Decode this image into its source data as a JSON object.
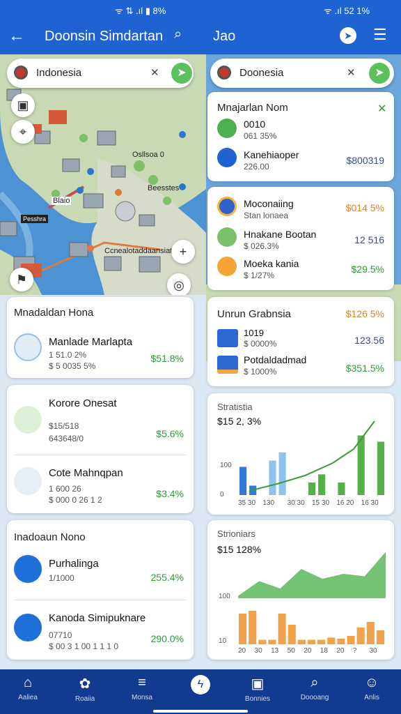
{
  "status": {
    "left": "ᯤ ⇅ .ıl ▮ 8%",
    "right": "ᯤ .ıl 52 1%"
  },
  "appbar": {
    "title": "Doonsin Simdartan",
    "title2": "Jao"
  },
  "map_left": {
    "search_text": "Indonesia",
    "labels": [
      "Osllsoa 0",
      "Beesstes",
      "Blaio",
      "Pesshra",
      "Ccnealotaddaansiate"
    ]
  },
  "map_right": {
    "search_text": "Doonesia"
  },
  "popup1": {
    "title": "Mnajarlan Nom",
    "items": [
      {
        "name": "0010",
        "sub": "061 35%",
        "value": ""
      },
      {
        "name": "Kanehiaoper",
        "sub": "226.00",
        "value": "$800319"
      }
    ]
  },
  "popup2": {
    "items": [
      {
        "name": "Moconaiing",
        "sub": "Stan lonaea",
        "value": "$014 5%"
      },
      {
        "name": "Hnakane Bootan",
        "sub": "$ 026.3%",
        "value": "12 516"
      },
      {
        "name": "Moeka kania",
        "sub": "$ 1/27%",
        "value": "$29.5%"
      }
    ]
  },
  "card_a": {
    "title": "Mnadaldan Hona",
    "items": [
      {
        "name": "Manlade Marlapta",
        "sub1": "1 51.0 2%",
        "sub2": "$ 5 0035 5%",
        "value": "$51.8%"
      }
    ]
  },
  "card_b": {
    "items": [
      {
        "name": "Korore Onesat",
        "sub1": "$15/518",
        "sub2": "643648/0",
        "value": "$5.6%"
      },
      {
        "name": "Cote Mahnqpan",
        "sub1": "1 600 26",
        "sub2": "$ 000 0 26 1 2",
        "value": "$3.4%"
      }
    ]
  },
  "card_c": {
    "title": "Inadoaun Nono",
    "items": [
      {
        "name": "Purhalinga",
        "sub1": "1/1000",
        "value": "255.4%"
      },
      {
        "name": "Kanoda Simipuknare",
        "sub1": "07710",
        "sub2": "$ 00 3 1 00 1 1 1 0",
        "value": "290.0%"
      }
    ]
  },
  "card_d": {
    "title": "Unrun Grabnsia",
    "items": [
      {
        "name": "1019",
        "sub": "$ 0000%",
        "value": "123.56"
      },
      {
        "name": "Potdaldadmad",
        "sub": "$ 1000%",
        "value": "$351.5%"
      }
    ],
    "top_value": "$126 5%"
  },
  "chart1": {
    "title": "Stratistia",
    "big": "$15 2, 3%",
    "ytick": [
      "100",
      "0"
    ],
    "xticks": [
      "35 30",
      "130",
      "30 30",
      "15 30",
      "16 20",
      "16 30"
    ],
    "chart_data": {
      "type": "bar",
      "series": [
        {
          "values": [
            45,
            15,
            0,
            0,
            0,
            0,
            0,
            0,
            0,
            0,
            0,
            0,
            0,
            0,
            0
          ]
        },
        {
          "values": [
            0,
            0,
            0,
            55,
            68,
            0,
            0,
            0,
            0,
            0,
            0,
            0,
            0,
            0,
            0
          ]
        },
        {
          "values": [
            0,
            0,
            0,
            0,
            0,
            0,
            0,
            20,
            33,
            0,
            20,
            0,
            95,
            0,
            85
          ]
        }
      ]
    }
  },
  "chart2": {
    "title": "Strioniars",
    "big": "$15 128%",
    "ytick": [
      "100",
      "10"
    ],
    "xticks": [
      "20",
      "30",
      "13",
      "50",
      "20",
      "18",
      "20",
      "?",
      "30"
    ],
    "chart_data": {
      "type": "bar",
      "series": [
        {
          "name": "",
          "values": [
            55,
            60,
            8,
            8,
            55,
            35,
            8,
            8,
            8,
            12,
            10,
            15,
            30,
            40,
            25
          ]
        }
      ],
      "area": [
        5,
        35,
        20,
        60,
        40,
        50,
        45,
        95
      ]
    }
  },
  "nav": [
    {
      "icon": "home-icon",
      "label": "Aaliea"
    },
    {
      "icon": "gift-icon",
      "label": "Roaiia"
    },
    {
      "icon": "list-icon",
      "label": "Monsa"
    },
    {
      "icon": "bolt-icon",
      "label": ""
    },
    {
      "icon": "box-icon",
      "label": "Bonnies"
    },
    {
      "icon": "search-icon",
      "label": "Doooang"
    },
    {
      "icon": "user-icon",
      "label": "Anlis"
    }
  ]
}
